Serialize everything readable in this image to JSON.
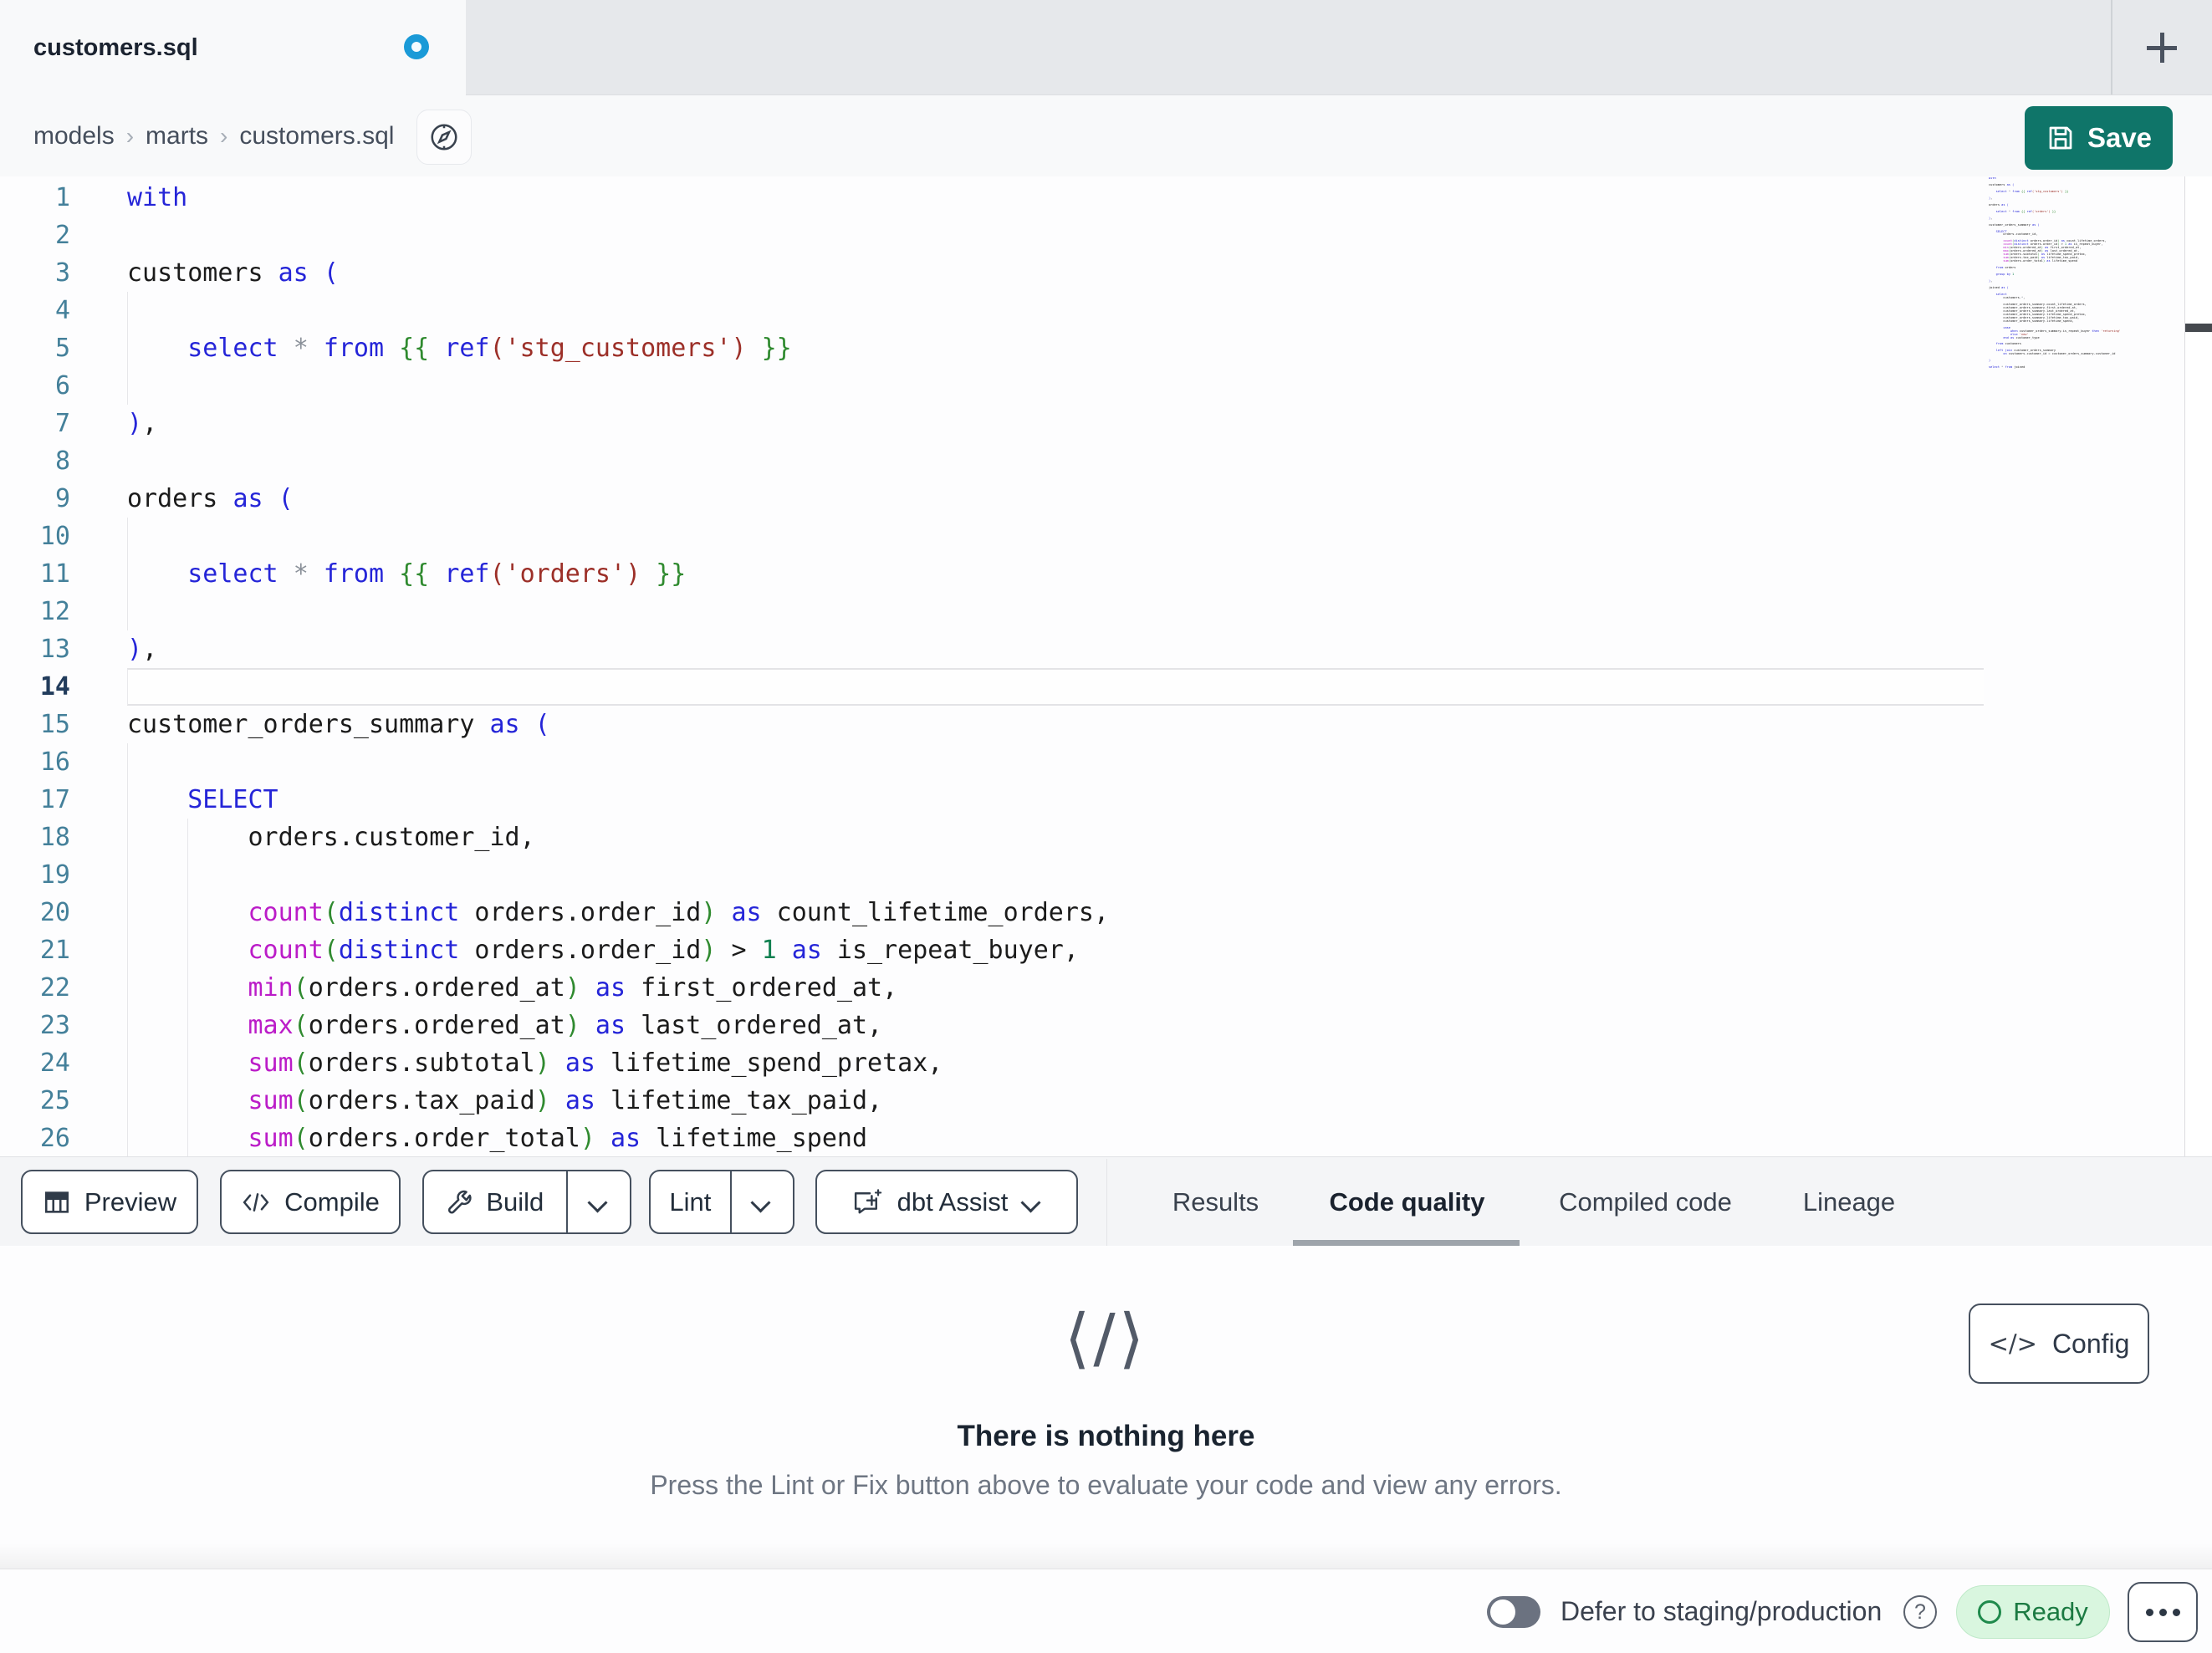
{
  "tab_bar": {
    "active_tab": {
      "title": "customers.sql",
      "modified": true
    },
    "new_tab_tooltip": "+"
  },
  "breadcrumb": {
    "items": [
      "models",
      "marts",
      "customers.sql"
    ],
    "separator": "›"
  },
  "header": {
    "save_label": "Save"
  },
  "editor": {
    "active_line": 14,
    "lines": [
      "with",
      "",
      "customers as (",
      "",
      "    select * from {{ ref('stg_customers') }}",
      "",
      "),",
      "",
      "orders as (",
      "",
      "    select * from {{ ref('orders') }}",
      "",
      "),",
      "",
      "customer_orders_summary as (",
      "",
      "    SELECT",
      "        orders.customer_id,",
      "",
      "        count(distinct orders.order_id) as count_lifetime_orders,",
      "        count(distinct orders.order_id) > 1 as is_repeat_buyer,",
      "        min(orders.ordered_at) as first_ordered_at,",
      "        max(orders.ordered_at) as last_ordered_at,",
      "        sum(orders.subtotal) as lifetime_spend_pretax,",
      "        sum(orders.tax_paid) as lifetime_tax_paid,",
      "        sum(orders.order_total) as lifetime_spend"
    ],
    "minimap_extra_lines": [
      "",
      "    from orders",
      "",
      "    group by 1",
      "",
      "),",
      "",
      "joined as (",
      "",
      "    select",
      "        customers.*,",
      "",
      "        customer_orders_summary.count_lifetime_orders,",
      "        customer_orders_summary.first_ordered_at,",
      "        customer_orders_summary.last_ordered_at,",
      "        customer_orders_summary.lifetime_spend_pretax,",
      "        customer_orders_summary.lifetime_tax_paid,",
      "        customer_orders_summary.lifetime_spend,",
      "",
      "        case",
      "            when customer_orders_summary.is_repeat_buyer then 'returning'",
      "            else 'new'",
      "        end as customer_type",
      "",
      "    from customers",
      "",
      "    left join customer_orders_summary",
      "        on customers.customer_id = customer_orders_summary.customer_id",
      "",
      ")",
      "",
      "select * from joined"
    ]
  },
  "toolbar": {
    "preview_label": "Preview",
    "compile_label": "Compile",
    "build_label": "Build",
    "lint_label": "Lint",
    "assist_label": "dbt Assist"
  },
  "result_tabs": {
    "items": [
      {
        "label": "Results",
        "active": false
      },
      {
        "label": "Code quality",
        "active": true
      },
      {
        "label": "Compiled code",
        "active": false
      },
      {
        "label": "Lineage",
        "active": false
      }
    ]
  },
  "code_quality_panel": {
    "icon_glyph": "⟨/⟩",
    "title": "There is nothing here",
    "subtitle": "Press the Lint or Fix button above to evaluate your code and view any errors.",
    "config_label": "Config",
    "config_icon_glyph": "</>"
  },
  "status_bar": {
    "defer_toggle_on": false,
    "defer_label": "Defer to staging/production",
    "status_label": "Ready"
  },
  "colors": {
    "save_button": "#0f7569",
    "unsaved_dot": "#1a9ad7",
    "ready_bg": "#d9f6df",
    "ready_text": "#1b7a42",
    "syntax_keyword": "#2525d8",
    "syntax_string": "#9c2f28",
    "syntax_jinja_brace": "#2f8a2f",
    "syntax_function": "#bb1cc8",
    "syntax_number": "#108050",
    "line_number": "#44809a",
    "active_line_number": "#223c5c"
  }
}
